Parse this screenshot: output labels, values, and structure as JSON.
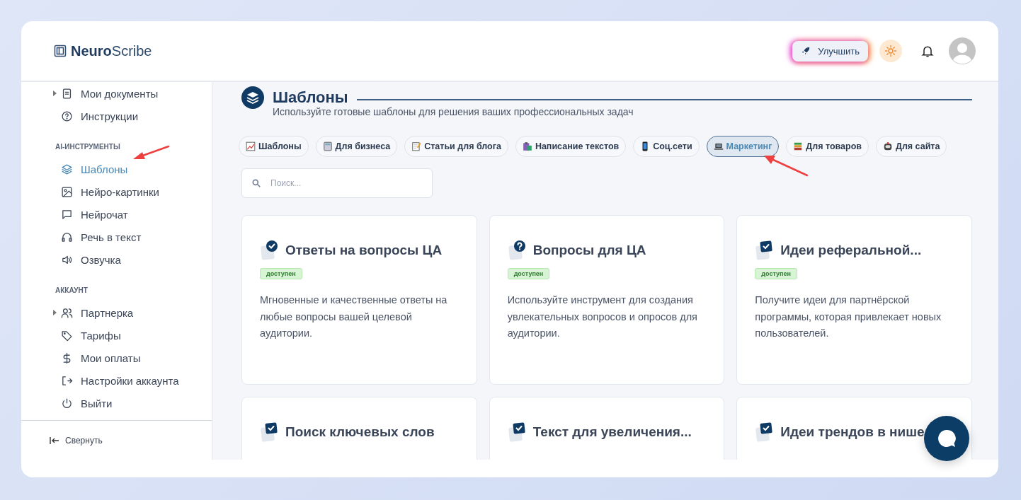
{
  "header": {
    "logo": {
      "bold": "Neuro",
      "light": "Scribe"
    },
    "upgrade_button": "Улучшить"
  },
  "sidebar": {
    "sections": [
      {
        "items": [
          {
            "label": "Мои документы",
            "expandable": true,
            "selected": false
          },
          {
            "label": "Инструкции",
            "expandable": false,
            "selected": false
          }
        ]
      },
      {
        "label": "AI-ИНСТРУМЕНТЫ",
        "items": [
          {
            "label": "Шаблоны",
            "expandable": false,
            "selected": true
          },
          {
            "label": "Нейро-картинки",
            "expandable": false,
            "selected": false
          },
          {
            "label": "Нейрочат",
            "expandable": false,
            "selected": false
          },
          {
            "label": "Речь в текст",
            "expandable": false,
            "selected": false
          },
          {
            "label": "Озвучка",
            "expandable": false,
            "selected": false
          }
        ]
      },
      {
        "label": "АККАУНТ",
        "items": [
          {
            "label": "Партнерка",
            "expandable": true,
            "selected": false
          },
          {
            "label": "Тарифы",
            "expandable": false,
            "selected": false
          },
          {
            "label": "Мои оплаты",
            "expandable": false,
            "selected": false
          },
          {
            "label": "Настройки аккаунта",
            "expandable": false,
            "selected": false
          },
          {
            "label": "Выйти",
            "expandable": false,
            "selected": false
          }
        ]
      }
    ],
    "collapse": "Свернуть"
  },
  "page": {
    "title": "Шаблоны",
    "subtitle": "Используйте готовые шаблоны для решения ваших профессиональных задач"
  },
  "categories": [
    {
      "label": "Шаблоны",
      "selected": false
    },
    {
      "label": "Для бизнеса",
      "selected": false
    },
    {
      "label": "Статьи для блога",
      "selected": false
    },
    {
      "label": "Написание текстов",
      "selected": false
    },
    {
      "label": "Соц.сети",
      "selected": false
    },
    {
      "label": "Маркетинг",
      "selected": true
    },
    {
      "label": "Для товаров",
      "selected": false
    },
    {
      "label": "Для сайта",
      "selected": false
    }
  ],
  "search": {
    "placeholder": "Поиск..."
  },
  "cards": [
    {
      "title": "Ответы на вопросы ЦА",
      "badge": "доступен",
      "description": "Мгновенные и качественные ответы на любые вопросы вашей целевой аудитории."
    },
    {
      "title": "Вопросы для ЦА",
      "badge": "доступен",
      "description": "Используйте инструмент для создания увлекательных вопросов и опросов для аудитории."
    },
    {
      "title": "Идеи реферальной...",
      "badge": "доступен",
      "description": "Получите идеи для партнёрской программы, которая привлекает новых пользователей."
    },
    {
      "title": "Поиск ключевых слов"
    },
    {
      "title": "Текст для увеличения..."
    },
    {
      "title": "Идеи трендов в нише"
    }
  ]
}
